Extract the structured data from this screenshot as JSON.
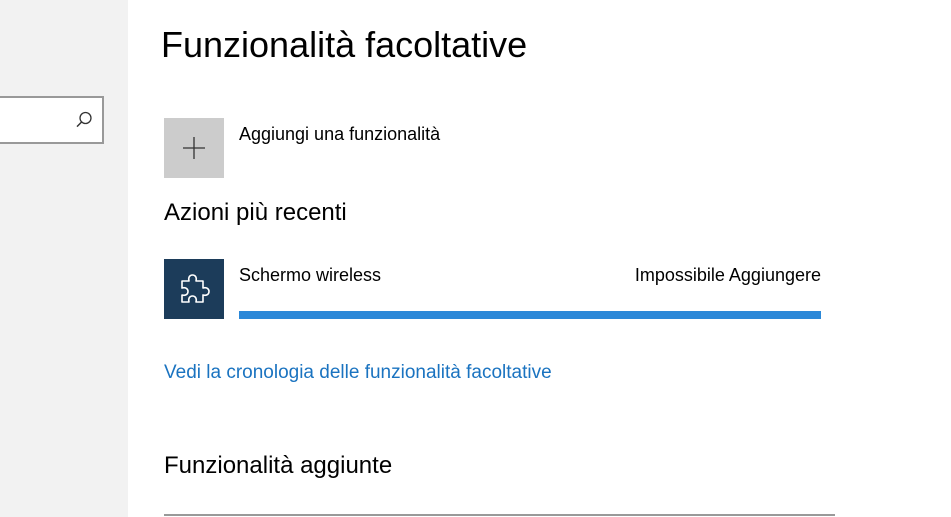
{
  "page": {
    "title": "Funzionalità facoltative",
    "add_feature_label": "Aggiungi una funzionalità",
    "recent_heading": "Azioni più recenti",
    "history_link": "Vedi la cronologia delle funzionalità facoltative",
    "installed_heading": "Funzionalità aggiunte"
  },
  "search": {
    "value": "",
    "icon": "search-icon"
  },
  "recent_actions": [
    {
      "name": "Schermo wireless",
      "status": "Impossibile Aggiungere",
      "icon": "puzzle-icon",
      "progress": 1.0
    }
  ],
  "colors": {
    "accent": "#2b88d8",
    "link": "#1a73c0",
    "feature_tile": "#1c3c5a",
    "sidebar": "#f2f2f2"
  }
}
